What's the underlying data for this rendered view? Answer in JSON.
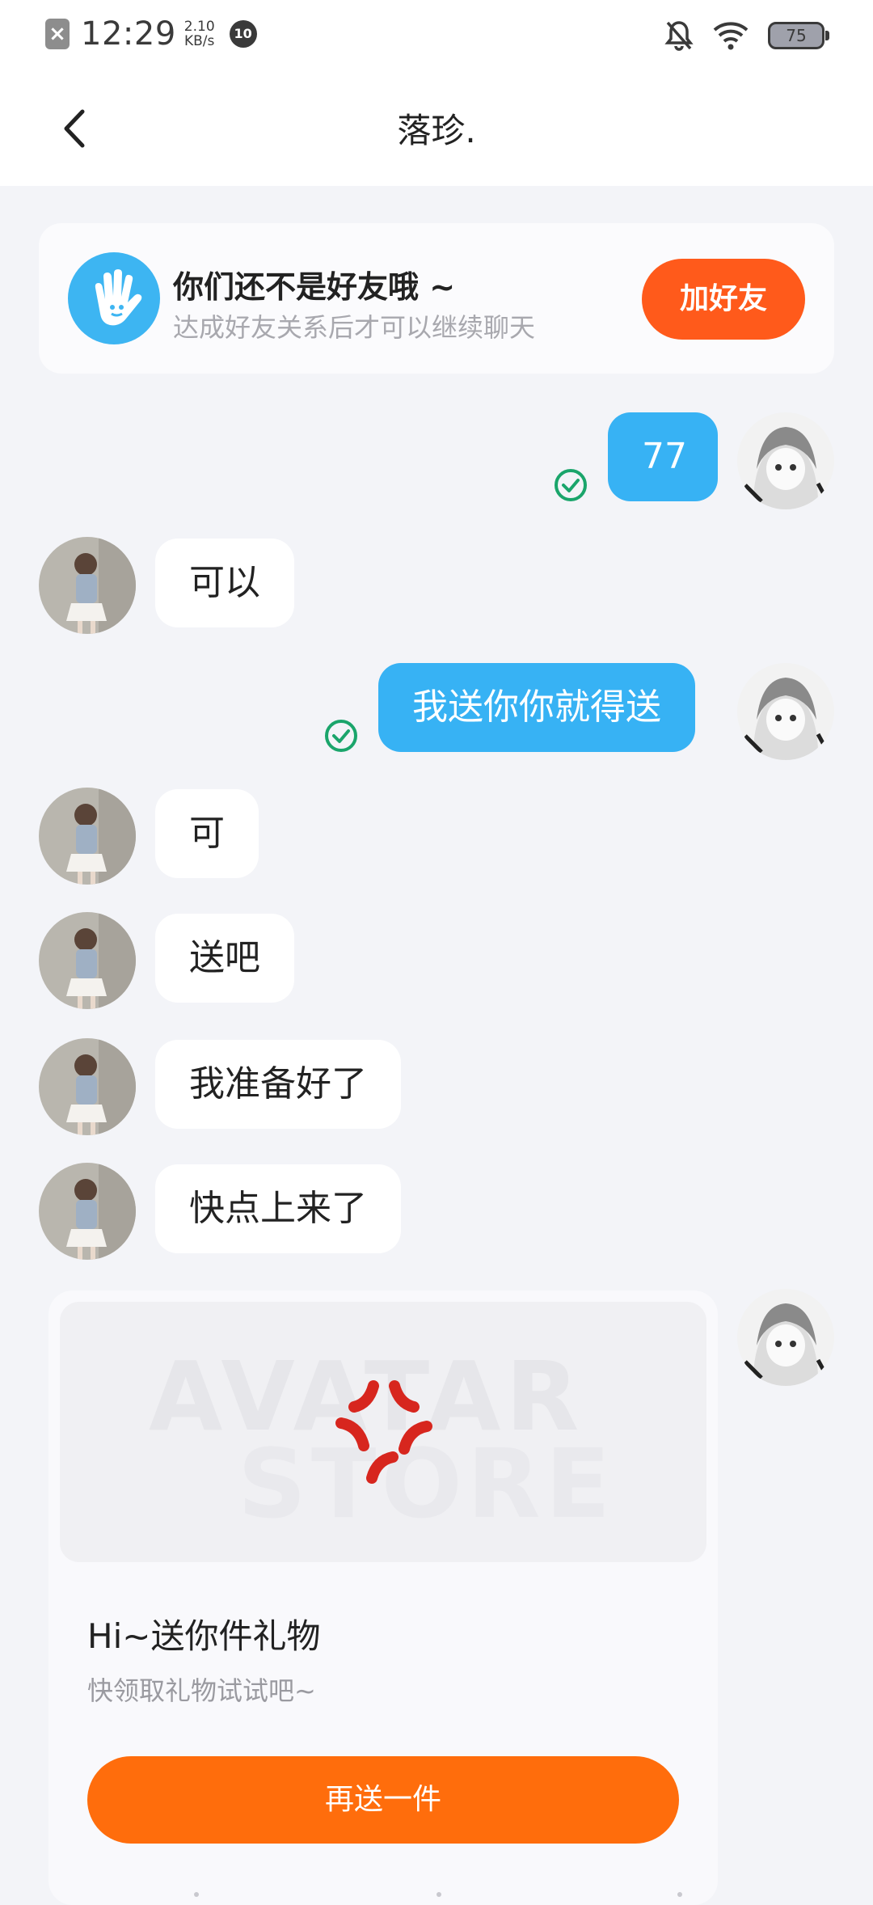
{
  "status_bar": {
    "time": "12:29",
    "speed_value": "2.10",
    "speed_unit": "KB/s",
    "notif_badge": "10",
    "battery": "75"
  },
  "header": {
    "title": "落珍."
  },
  "friend_notice": {
    "title": "你们还不是好友哦 ~",
    "subtitle": "达成好友关系后才可以继续聊天",
    "button": "加好友"
  },
  "messages": [
    {
      "side": "out",
      "text": "77"
    },
    {
      "side": "in",
      "text": "可以"
    },
    {
      "side": "out",
      "text": "我送你你就得送"
    },
    {
      "side": "in",
      "text": "可"
    },
    {
      "side": "in",
      "text": "送吧"
    },
    {
      "side": "in",
      "text": "我准备好了"
    },
    {
      "side": "in",
      "text": "快点上来了"
    }
  ],
  "gift_card": {
    "watermark_line1": "AVATAR",
    "watermark_line2": "STORE",
    "title": "Hi~送你件礼物",
    "subtitle": "快领取礼物试试吧~",
    "button": "再送一件"
  },
  "colors": {
    "accent_orange": "#ff5a1b",
    "bubble_blue": "#37b2f4",
    "check_green": "#1aa56b"
  }
}
